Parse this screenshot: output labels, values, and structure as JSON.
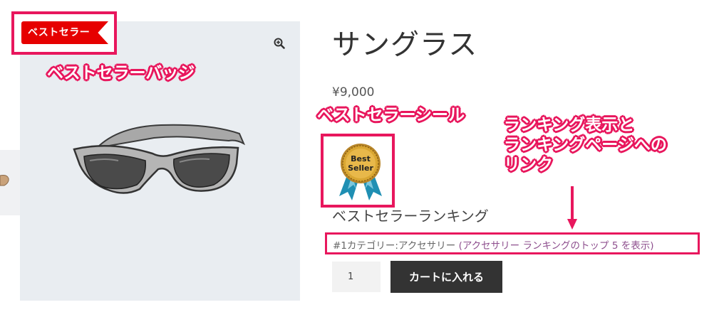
{
  "product": {
    "title": "サングラス",
    "price": "¥9,000"
  },
  "badge": {
    "label": "ベストセラー"
  },
  "seal": {
    "line1": "Best",
    "line2": "Seller"
  },
  "annotations": {
    "badge": "ベストセラーバッジ",
    "seal": "ベストセラーシール",
    "ranking_line1": "ランキング表示と",
    "ranking_line2": "ランキングページへの",
    "ranking_line3": "リンク"
  },
  "ranking": {
    "heading": "ベストセラーランキング",
    "rank": "#1",
    "category_text": "カテゴリー:アクセサリー",
    "link_text": "(アクセサリー ランキングのトップ 5 を表示)"
  },
  "cart": {
    "quantity": "1",
    "button_label": "カートに入れる"
  },
  "colors": {
    "annotation": "#e8175d",
    "badge": "#e60000",
    "cart_button": "#333333",
    "link": "#8e4f8e"
  }
}
